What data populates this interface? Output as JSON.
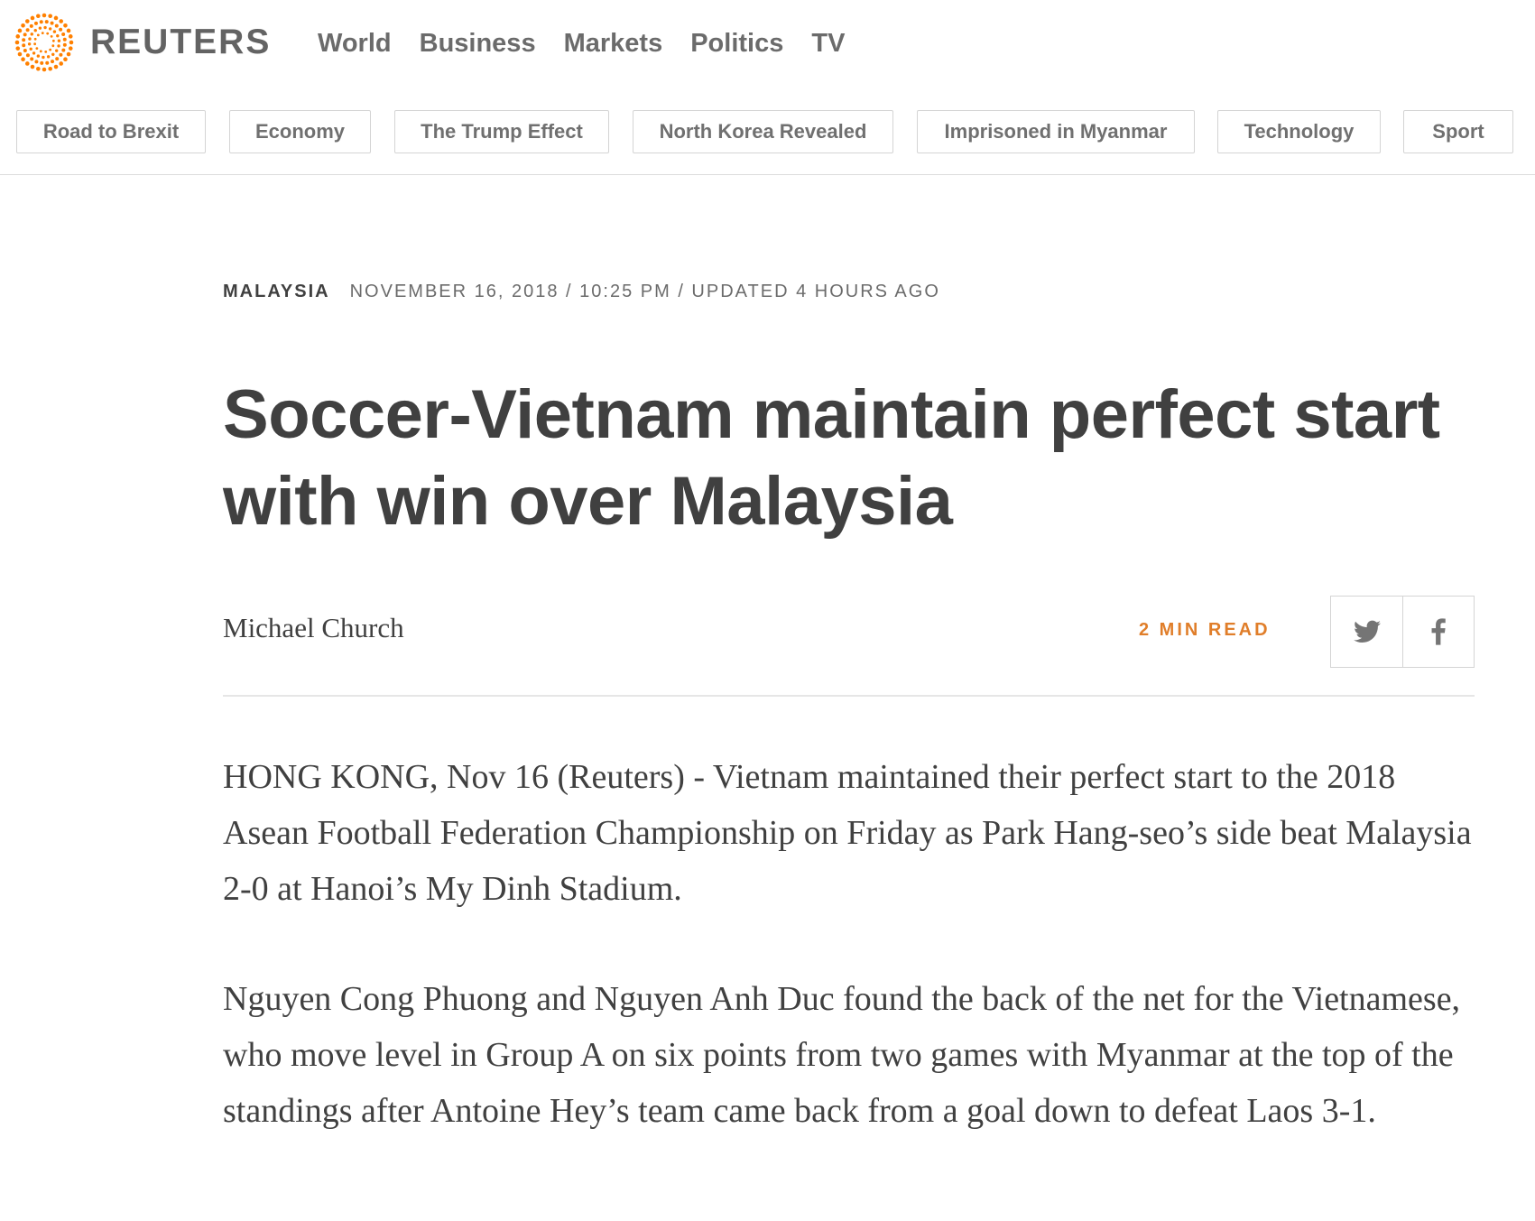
{
  "header": {
    "logo_text": "REUTERS",
    "logo_icon": "reuters-dot-ring-logo",
    "brand_color": "#ff8000",
    "nav": [
      "World",
      "Business",
      "Markets",
      "Politics",
      "TV"
    ]
  },
  "topics": [
    "Road to Brexit",
    "Economy",
    "The Trump Effect",
    "North Korea Revealed",
    "Imprisoned in Myanmar",
    "Technology",
    "Sport"
  ],
  "article": {
    "section": "MALAYSIA",
    "dateline": "NOVEMBER 16, 2018 / 10:25 PM / UPDATED 4 HOURS AGO",
    "headline": "Soccer-Vietnam maintain perfect start with win over Malaysia",
    "author": "Michael Church",
    "read_time": "2 MIN READ",
    "accent_color": "#e07e2a",
    "share_icons": [
      "twitter-icon",
      "facebook-icon"
    ],
    "paragraphs": [
      "HONG KONG, Nov 16 (Reuters) - Vietnam maintained their perfect start to the 2018 Asean Football Federation Championship on Friday as Park Hang-seo’s side beat Malaysia 2-0 at Hanoi’s My Dinh Stadium.",
      "Nguyen Cong Phuong and Nguyen Anh Duc found the back of the net for the Vietnamese, who move level in Group A on six points from two games with Myanmar at the top of the standings after Antoine Hey’s team came back from a goal down to defeat Laos 3-1."
    ]
  }
}
